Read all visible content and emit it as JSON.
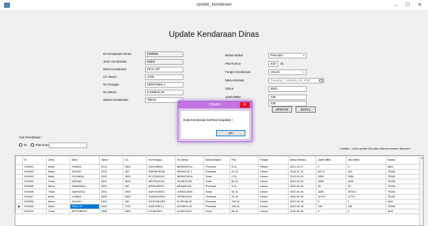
{
  "window": {
    "title": "update_kendaraan",
    "minimize": "–",
    "maximize": "☐",
    "close": "✕"
  },
  "heading": "Update Kendaraan Dinas",
  "form_left": {
    "id_label": "ID Kendaraan Dinas",
    "id_value": "K00009",
    "jenis_label": "Jenis Kendaraan",
    "jenis_value": "Mobil",
    "merk_label": "Merk Kendaraan",
    "merk_value": "PICK UP",
    "cc_label": "CC Mesin",
    "cc_value": "1700",
    "rangka_label": "No Rangka",
    "rangka_value": "KD5FGNKLJ",
    "mesin_label": "No Mesin",
    "mesin_value": "KJVMK4LJ5",
    "status_label": "Status Kendaraan",
    "status_value": "TIDAK"
  },
  "form_right": {
    "bbm_label": "Bahan Bakar",
    "bbm_value": "Premium",
    "plat_label": "Plat Nomor",
    "plat_value": "415",
    "plat_suffix_value": "31",
    "fungsi_label": "Fungsi Kendaraan",
    "fungsi_value": "Umum",
    "berlaku_label": "Masa Berlaku",
    "berlaku_value": "Tuesday ,   February  18, 2020",
    "tahun_label": "Tahun",
    "tahun_value": "2001",
    "jatah_label": "Jatah BBM",
    "jatah_value": "135",
    "sisa_label": "Sisa BBM",
    "sisa_value": "135",
    "update_button": "UPDATE",
    "batal_button": "BATAL"
  },
  "dialog": {
    "title": "DINAS",
    "close": "✕",
    "message": "Data Kendaraan berhasil diupdate !",
    "ok_button": "OK"
  },
  "search": {
    "label": "Cari Kendaraan :",
    "radio_id": "ID",
    "radio_plat": "Plat Nomor",
    "value": ""
  },
  "note": "*catatan : untuk update klik pada data kendaraan dibawah !",
  "grid": {
    "columns": [
      "ID",
      "Jenis",
      "Merk",
      "Tahun",
      "CC",
      "No Rangka",
      "No Mesin",
      "Bahan Bakar",
      "Plat",
      "Fungsi",
      "Masa Berlaku",
      "Jatah BBM",
      "Sisa BBM",
      "Status"
    ],
    "rows": [
      [
        "K00001",
        "Mobil",
        "HONDA",
        "2012",
        "2500",
        "KJDH4I6DK",
        "MEDRUF21L",
        "Premium",
        "5-31",
        "Patroli",
        "2021-03-17",
        "0",
        "0",
        "ADA"
      ],
      [
        "K00002",
        "Motor",
        "SUZUKI",
        "2012",
        "150",
        "RNFWK3K3N",
        "MRHKKJK J",
        "Premium",
        "22-31",
        "Umum",
        "2018-07-12",
        "547.5",
        "400",
        "TIDAK"
      ],
      [
        "K00003",
        "Mobil",
        "HYUNDAI",
        "2005",
        "3500",
        "KFJC3KJGLK",
        "MERKK3KJA",
        "Solar",
        "2-31",
        "Umum",
        "2019-01-29",
        "3285",
        "3285",
        "TIDAK"
      ],
      [
        "K00004",
        "Truck",
        "NISSAN",
        "2001",
        "5000",
        "MRJF3JKJGJ",
        "KAJ3KGJ3K",
        "Solar",
        "84-31",
        "Umum",
        "2020-02-26",
        "3285",
        "2000",
        "TIDAK"
      ],
      [
        "K00005",
        "Motor",
        "KAWASAKI",
        "2001",
        "250",
        "MFRU2ZKGJ",
        "MRNAKG31",
        "Premium",
        "3-31",
        "Umum",
        "2020-02-26",
        "20",
        "20",
        "TIDAK"
      ],
      [
        "K00006",
        "Truck",
        "DAIHATSU",
        "2001",
        "2500",
        "KAKF3GKKG",
        "JH3KGUKDK",
        "Solar",
        "92-31",
        "Umum",
        "2020-02-26",
        "3285",
        "3076.5",
        "TIDAK"
      ],
      [
        "K00007",
        "Mobil",
        "HONDA",
        "2009",
        "2000",
        "JKA3A2DSFG",
        "JF3SDKJSK",
        "Premium",
        "23-31",
        "Patroli",
        "2020-02-18",
        "10710",
        "10710",
        "TIDAK"
      ],
      [
        "K00008",
        "Motor",
        "SUZUKI",
        "2003",
        "150",
        "KDJFK3K2SD",
        "KL5FHAKJ5",
        "Premium",
        "748-31",
        "Patroli",
        "2020-02-18",
        "0",
        "0",
        "ADA"
      ],
      [
        "K00009",
        "Mobil",
        "PICK UP",
        "2004",
        "1700",
        "KD5FGNKLJ",
        "KJVMK4LJ5",
        "Premium",
        "415-31",
        "Umum",
        "2020-02-18",
        "135",
        "135",
        "TIDAK"
      ],
      [
        "K00010",
        "Truck",
        "MITSUBISHI",
        "2006",
        "2500",
        "KSJ4KJDFL",
        "4LSDFU4J4",
        "Solar",
        "58-31",
        "Umum",
        "2020-02-26",
        "0",
        "0",
        "ADA"
      ]
    ],
    "selected_row": 8,
    "row_indicator": "▶"
  }
}
